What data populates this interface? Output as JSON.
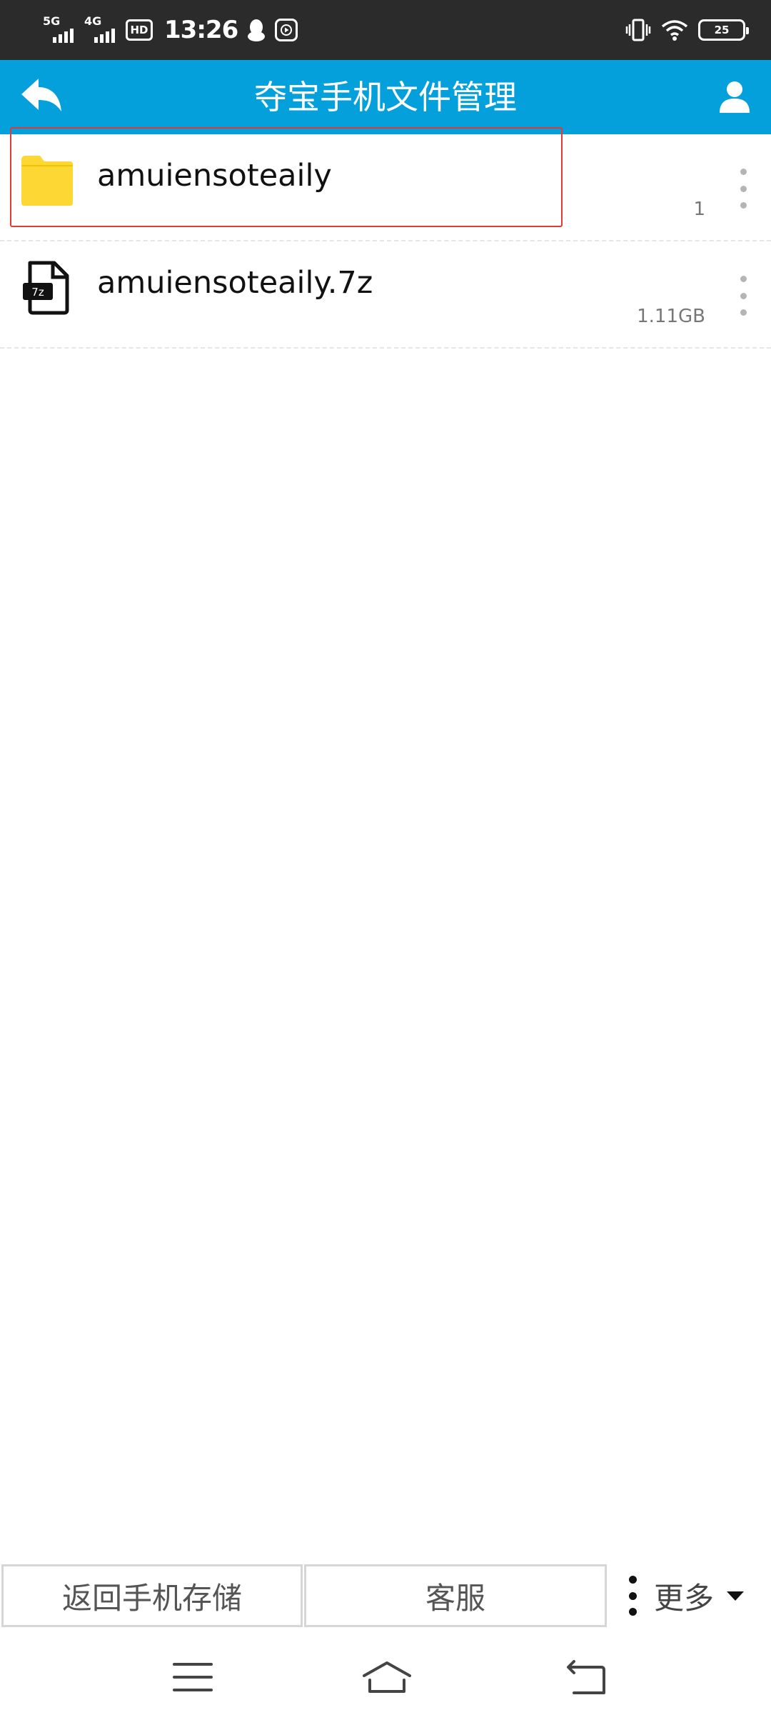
{
  "status_bar": {
    "signal1_label": "5G",
    "signal2_label": "4G",
    "hd_label": "HD",
    "time": "13:26",
    "battery_level": "25"
  },
  "app_bar": {
    "title": "夺宝手机文件管理",
    "back_icon": "back-arrow-icon",
    "user_icon": "user-icon"
  },
  "files": [
    {
      "name": "amuiensoteaily",
      "meta": "1",
      "type": "folder",
      "icon": "folder-icon",
      "icon_color": "#FDD835"
    },
    {
      "name": "amuiensoteaily.7z",
      "meta": "1.11GB",
      "type": "archive",
      "icon": "7z-file-icon",
      "icon_badge": "7z"
    }
  ],
  "toolbar": {
    "back_storage_label": "返回手机存储",
    "support_label": "客服",
    "more_label": "更多"
  },
  "colors": {
    "app_bar": "#03A0DC",
    "status_bar": "#2B2B2B",
    "highlight": "#E53935",
    "folder": "#FDD835"
  }
}
